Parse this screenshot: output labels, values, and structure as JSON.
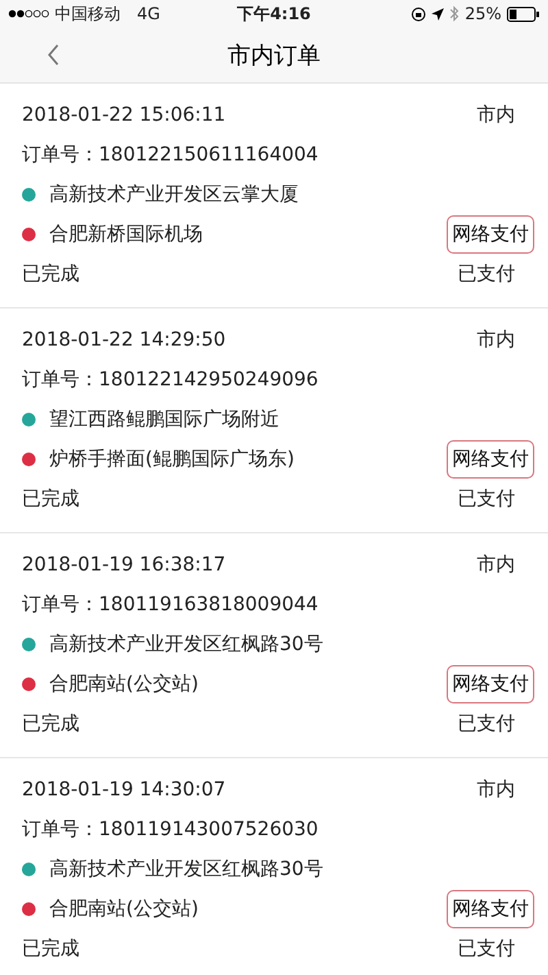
{
  "status_bar": {
    "carrier": "中国移动",
    "network": "4G",
    "time": "下午4:16",
    "battery": "25%"
  },
  "nav": {
    "title": "市内订单"
  },
  "orders": [
    {
      "datetime": "2018-01-22 15:06:11",
      "type": "市内",
      "order_label": "订单号：",
      "order_no": "180122150611164004",
      "stops": [
        {
          "text": "高新技术产业开发区云掌大厦",
          "color": "#26a69a"
        },
        {
          "text": "合肥新桥国际机场",
          "color": "#dc2f45"
        }
      ],
      "pay_method": "网络支付",
      "status": "已完成",
      "pay_status": "已支付"
    },
    {
      "datetime": "2018-01-22 14:29:50",
      "type": "市内",
      "order_label": "订单号：",
      "order_no": "180122142950249096",
      "stops": [
        {
          "text": "望江西路鲲鹏国际广场附近",
          "color": "#26a69a"
        },
        {
          "text": "炉桥手擀面(鲲鹏国际广场东)",
          "color": "#dc2f45"
        }
      ],
      "pay_method": "网络支付",
      "status": "已完成",
      "pay_status": "已支付"
    },
    {
      "datetime": "2018-01-19 16:38:17",
      "type": "市内",
      "order_label": "订单号：",
      "order_no": "180119163818009044",
      "stops": [
        {
          "text": "高新技术产业开发区红枫路30号",
          "color": "#26a69a"
        },
        {
          "text": "合肥南站(公交站)",
          "color": "#dc2f45"
        }
      ],
      "pay_method": "网络支付",
      "status": "已完成",
      "pay_status": "已支付"
    },
    {
      "datetime": "2018-01-19 14:30:07",
      "type": "市内",
      "order_label": "订单号：",
      "order_no": "180119143007526030",
      "stops": [
        {
          "text": "高新技术产业开发区红枫路30号",
          "color": "#26a69a"
        },
        {
          "text": "合肥南站(公交站)",
          "color": "#dc2f45"
        }
      ],
      "pay_method": "网络支付",
      "status": "已完成",
      "pay_status": "已支付"
    }
  ]
}
